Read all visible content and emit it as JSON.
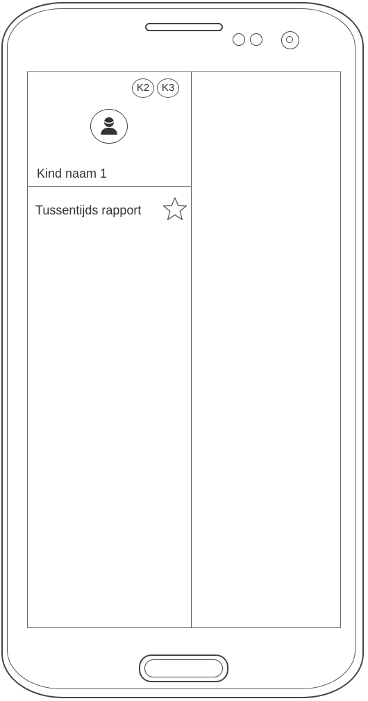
{
  "phone": {
    "hardware": [
      "speaker-grille",
      "proximity-sensor",
      "light-sensor",
      "front-camera",
      "home-button"
    ]
  },
  "child": {
    "name": "Kind naam 1",
    "badges": [
      "K2",
      "K3"
    ],
    "avatar_icon": "user-avatar-icon"
  },
  "menu": {
    "items": [
      {
        "label": "Tussentijds rapport",
        "icon": "star-icon"
      }
    ]
  }
}
